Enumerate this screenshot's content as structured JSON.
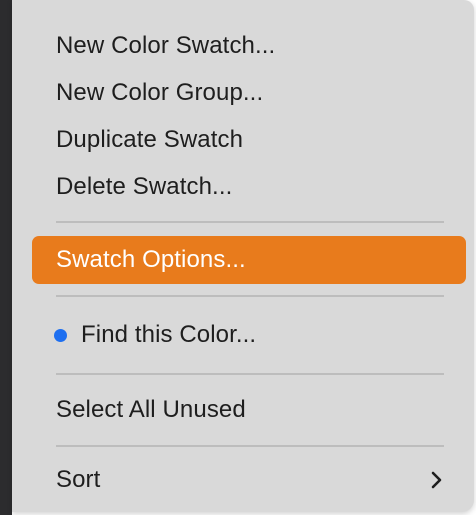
{
  "menu": {
    "items": [
      {
        "label": "New Color Swatch..."
      },
      {
        "label": "New Color Group..."
      },
      {
        "label": "Duplicate Swatch"
      },
      {
        "label": "Delete Swatch..."
      },
      {
        "label": "Swatch Options..."
      },
      {
        "label": "Find this Color..."
      },
      {
        "label": "Select All Unused"
      },
      {
        "label": "Sort"
      }
    ]
  },
  "colors": {
    "highlight": "#e87b1c",
    "dot": "#1e6ff0",
    "menu_bg": "#d9d9d9"
  },
  "icons": {
    "find_color": "blue-dot-icon",
    "sort_submenu": "chevron-right-icon"
  }
}
